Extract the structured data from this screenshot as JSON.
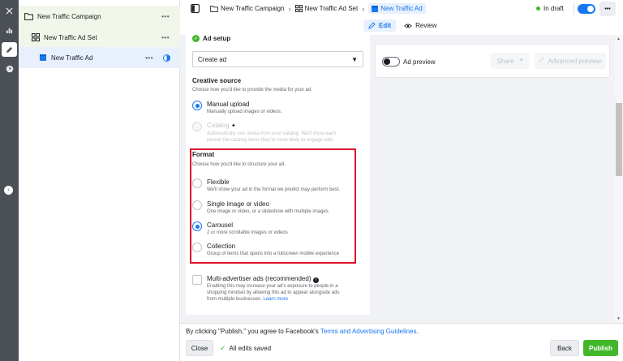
{
  "rail": {
    "close_icon": "close-icon",
    "chart_icon": "chart-icon",
    "edit_icon": "pencil-icon",
    "history_icon": "clock-icon",
    "collapse_icon": "chevron-left-icon"
  },
  "tree": {
    "campaign_label": "New Traffic Campaign",
    "adset_label": "New Traffic Ad Set",
    "ad_label": "New Traffic Ad",
    "more": "•••"
  },
  "breadcrumb": {
    "campaign": "New Traffic Campaign",
    "adset": "New Traffic Ad Set",
    "ad": "New Traffic Ad"
  },
  "status": {
    "label": "In draft",
    "more": "•••"
  },
  "tabs": {
    "edit": "Edit",
    "review": "Review"
  },
  "ad_setup": {
    "title": "Ad setup",
    "select_value": "Create ad"
  },
  "creative_source": {
    "title": "Creative source",
    "description": "Choose how you'd like to provide the media for your ad.",
    "options": [
      {
        "title": "Manual upload",
        "sub": "Manually upload images or videos.",
        "checked": true
      },
      {
        "title": "Catalog",
        "sub1": "Automatically use media from your catalog. We'll show each",
        "sub2": "person the catalog items they're most likely to engage with.",
        "checked": false
      }
    ]
  },
  "format": {
    "title": "Format",
    "description": "Choose how you'd like to structure your ad.",
    "options": [
      {
        "title": "Flexible",
        "sub": "We'll show your ad in the format we predict may perform best.",
        "checked": false
      },
      {
        "title": "Single image or video",
        "sub": "One image or video, or a slideshow with multiple images",
        "checked": false
      },
      {
        "title": "Carousel",
        "sub": "2 or more scrollable images or videos",
        "checked": true
      },
      {
        "title": "Collection",
        "sub": "Group of items that opens into a fullscreen mobile experience",
        "checked": false
      }
    ]
  },
  "multi_advertiser": {
    "title": "Multi-advertiser ads (recommended)",
    "line1": "Enabling this may increase your ad's exposure to people in a",
    "line2": "shopping mindset by allowing this ad to appear alongside ads",
    "line3": "from multiple businesses.",
    "learn_more": "Learn more"
  },
  "preview": {
    "label": "Ad preview",
    "share": "Share",
    "advanced": "Advanced preview"
  },
  "footer": {
    "notice_prefix": "By clicking \"Publish,\" you agree to Facebook's ",
    "notice_link": "Terms and Advertising Guidelines",
    "notice_suffix": ".",
    "close": "Close",
    "saved": "All edits saved",
    "back": "Back",
    "publish": "Publish"
  },
  "colors": {
    "accent": "#1877f2",
    "publish_green": "#42b72a",
    "highlight_red": "#e0102a",
    "rail": "#4b4f56"
  }
}
